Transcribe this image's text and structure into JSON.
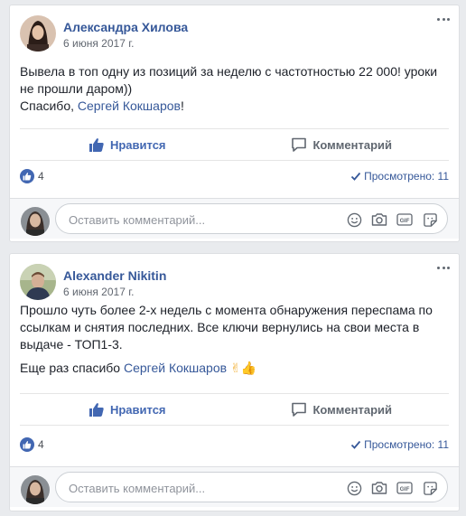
{
  "posts": [
    {
      "author": "Александра Хилова",
      "date": "6 июня 2017 г.",
      "text_1": "Вывела в топ одну из позиций за неделю с частотностью 22 000! уроки не прошли даром))",
      "text_2_prefix": "Спасибо, ",
      "mention": "Сергей Кокшаров",
      "text_2_suffix": "!",
      "like_label": "Нравится",
      "comment_label": "Комментарий",
      "likes_count": "4",
      "seen_label": "Просмотрено: 11",
      "comment_placeholder": "Оставить комментарий..."
    },
    {
      "author": "Alexander Nikitin",
      "date": "6 июня 2017 г.",
      "text_1": "Прошло чуть более 2-х недель с момента обнаружения переспама по ссылкам и снятия последних. Все ключи вернулись на свои места в выдаче - ТОП1-3.",
      "text_2_prefix": "Еще раз спасибо ",
      "mention": "Сергей Кокшаров",
      "emoji": "✌👍",
      "like_label": "Нравится",
      "comment_label": "Комментарий",
      "likes_count": "4",
      "seen_label": "Просмотрено: 11",
      "comment_placeholder": "Оставить комментарий..."
    }
  ],
  "icons": {
    "more": "ellipsis-icon",
    "like": "thumbs-up-icon",
    "comment": "speech-bubble-icon",
    "seen": "checkmark-icon",
    "emoji": "smiley-icon",
    "camera": "camera-icon",
    "gif": "gif-icon",
    "sticker": "sticker-icon"
  },
  "colors": {
    "accent": "#4267b2",
    "link": "#365899",
    "background": "#e9ebee"
  }
}
